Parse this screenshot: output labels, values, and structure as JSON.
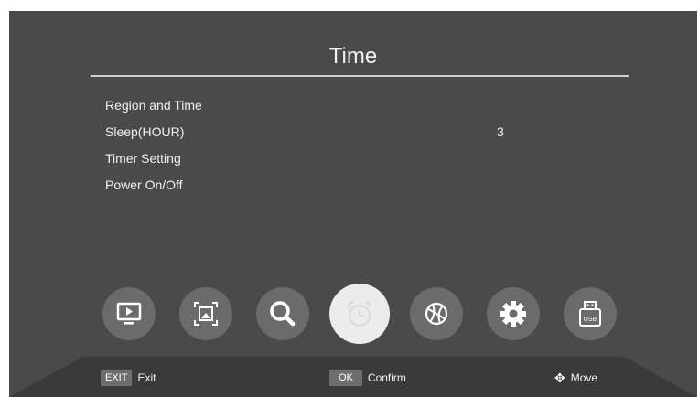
{
  "screen": {
    "title": "Time"
  },
  "menu": {
    "items": [
      {
        "label": "Region and Time",
        "value": ""
      },
      {
        "label": "Sleep(HOUR)",
        "value": "3"
      },
      {
        "label": "Timer Setting",
        "value": ""
      },
      {
        "label": "Power On/Off",
        "value": ""
      }
    ]
  },
  "icons": [
    {
      "name": "tv-icon",
      "active": false
    },
    {
      "name": "picture-icon",
      "active": false
    },
    {
      "name": "search-icon",
      "active": false
    },
    {
      "name": "alarm-clock-icon",
      "active": true
    },
    {
      "name": "network-globe-icon",
      "active": false
    },
    {
      "name": "settings-gear-icon",
      "active": false
    },
    {
      "name": "usb-icon",
      "active": false,
      "label": "USB"
    }
  ],
  "footer": {
    "exit_key": "EXIT",
    "exit_label": "Exit",
    "ok_key": "OK",
    "ok_label": "Confirm",
    "move_label": "Move"
  },
  "colors": {
    "background": "#4a4a4a",
    "icon_inactive": "#6b6b6b",
    "icon_active": "#ececec",
    "footer_bar": "#3a3a3a"
  }
}
